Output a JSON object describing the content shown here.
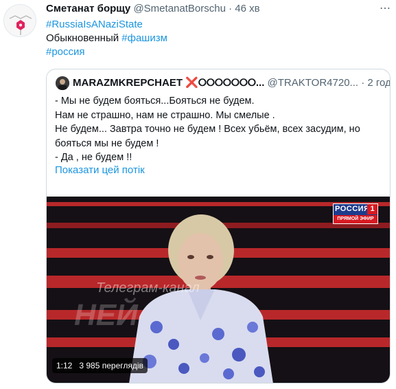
{
  "tweet": {
    "author_name": "Сметанат борщу",
    "author_handle": "@SmetanatBorschu",
    "separator": " · ",
    "time": "46 хв",
    "more_icon": "more-dots-icon",
    "line1_hashtag": "#RussiaIsANaziState",
    "line2_prefix": "Обыкновенный ",
    "line2_hashtag": "#фашизм",
    "line3_hashtag": "#россия"
  },
  "quoted": {
    "author_name": "MARAZMKREPCHAET",
    "cross": "❌",
    "circles": "⭘⭘⭘⭘⭘⭘⭘...",
    "author_handle": "@TRAKTOR4720...",
    "separator": " · ",
    "time": "2 год",
    "lines": [
      "- Мы не будем бояться...Бояться не будем.",
      "Нам не страшно, нам не страшно. Мы смелые .",
      "Не будем... Завтра точно не будем ! Всех убьём, всех засудим, но",
      "бояться мы не будем !",
      "- Да , не будем !!"
    ],
    "show_thread": "Показати цей потік"
  },
  "video": {
    "channel": "РОССИЯ",
    "channel_number": "1",
    "live_label": "ПРЯМОЙ ЭФИР",
    "watermark_text": "Телеграм-канал",
    "watermark_brand": "НЕЙ",
    "duration": "1:12",
    "views": "3 985 переглядів"
  },
  "colors": {
    "link": "#1b95e0",
    "muted": "#536471",
    "text": "#0f1419",
    "border": "#cfd9de",
    "accent_red": "#d71921"
  }
}
